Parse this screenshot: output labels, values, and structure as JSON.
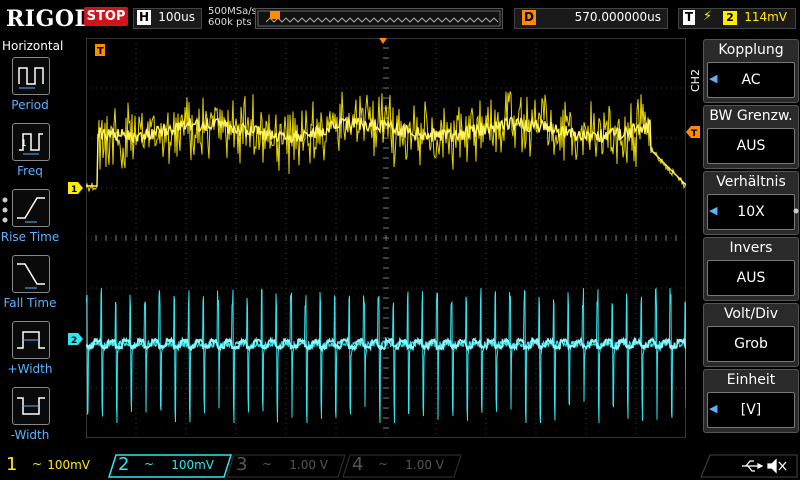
{
  "header": {
    "logo": "RIGOL",
    "run_state": "STOP",
    "timebase_label": "H",
    "timebase_value": "100us",
    "sample_rate": "500MSa/s",
    "memory_depth": "600k pts",
    "delay_label": "D",
    "delay_value": "570.000000us",
    "trigger_label": "T",
    "trigger_channel": "2",
    "trigger_level": "114mV"
  },
  "left_menu": {
    "title": "Horizontal",
    "items": [
      {
        "label": "Period",
        "icon": "period-icon"
      },
      {
        "label": "Freq",
        "icon": "freq-icon"
      },
      {
        "label": "Rise Time",
        "icon": "rise-time-icon"
      },
      {
        "label": "Fall Time",
        "icon": "fall-time-icon"
      },
      {
        "label": "+Width",
        "icon": "pos-width-icon"
      },
      {
        "label": "-Width",
        "icon": "neg-width-icon"
      }
    ]
  },
  "right_menu": {
    "channel": "CH2",
    "items": [
      {
        "title": "Kopplung",
        "value": "AC",
        "has_arrow": true
      },
      {
        "title": "BW Grenzw.",
        "value": "AUS",
        "has_arrow": false
      },
      {
        "title": "Verhältnis",
        "value": "10X",
        "has_arrow": true
      },
      {
        "title": "Invers",
        "value": "AUS",
        "has_arrow": false
      },
      {
        "title": "Volt/Div",
        "value": "Grob",
        "has_arrow": false
      },
      {
        "title": "Einheit",
        "value": "[V]",
        "has_arrow": true
      }
    ]
  },
  "markers": {
    "ch1": "1",
    "ch2": "2",
    "trigger_pos": "T"
  },
  "channels": [
    {
      "num": "1",
      "coupling": "~",
      "scale": "100mV",
      "color": "#ffeb00",
      "active": true
    },
    {
      "num": "2",
      "coupling": "~",
      "scale": "100mV",
      "color": "#2ee6f0",
      "active": true
    },
    {
      "num": "3",
      "coupling": "~",
      "scale": "1.00 V",
      "color": "#c040c0",
      "active": false
    },
    {
      "num": "4",
      "coupling": "~",
      "scale": "1.00 V",
      "color": "#4070d0",
      "active": false
    }
  ],
  "colors": {
    "ch1": "#ffeb00",
    "ch2": "#2ee6f0",
    "accent": "#58b4ff",
    "stop": "#d0141c",
    "trigger": "#ff8c00"
  }
}
